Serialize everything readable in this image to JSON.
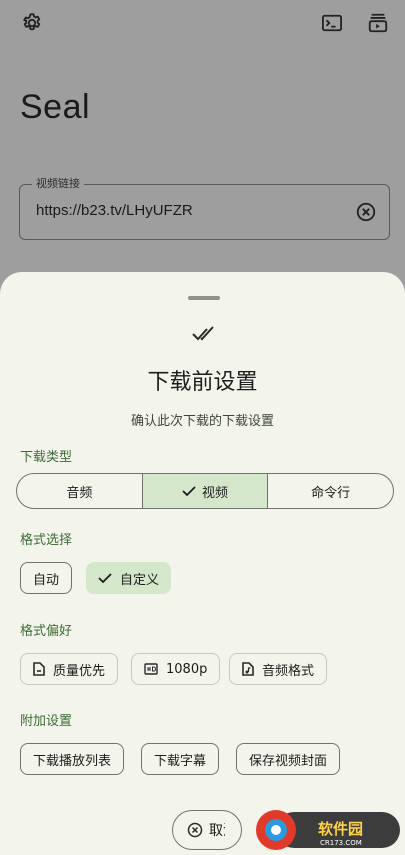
{
  "app": {
    "title": "Seal",
    "url_field": {
      "label": "视频链接",
      "value": "https://b23.tv/LHyUFZR"
    },
    "icons": {
      "settings": "gear-icon",
      "terminal": "terminal-icon",
      "queue": "download-queue-icon",
      "clear": "clear-circle-icon"
    }
  },
  "sheet": {
    "title": "下载前设置",
    "description": "确认此次下载的下载设置",
    "download_type": {
      "label": "下载类型",
      "options": [
        "音频",
        "视频",
        "命令行"
      ],
      "selected": "视频"
    },
    "format_selection": {
      "label": "格式选择",
      "chips": [
        "自动",
        "自定义"
      ],
      "selected": "自定义"
    },
    "format_preference": {
      "label": "格式偏好",
      "chips": [
        "质量优先",
        "1080p",
        "音频格式"
      ]
    },
    "extra_settings": {
      "label": "附加设置",
      "chips": [
        "下载播放列表",
        "下载字幕",
        "保存视频封面"
      ]
    },
    "cancel_button": {
      "label": "取消"
    }
  },
  "watermark": {
    "text": "软件园",
    "subtext": "CR173.COM"
  },
  "colors": {
    "accent": "#3d6b35",
    "selected_bg": "#d5e7cb",
    "sheet_bg": "#f3f5ec",
    "scrim": "#9e9e9e"
  }
}
